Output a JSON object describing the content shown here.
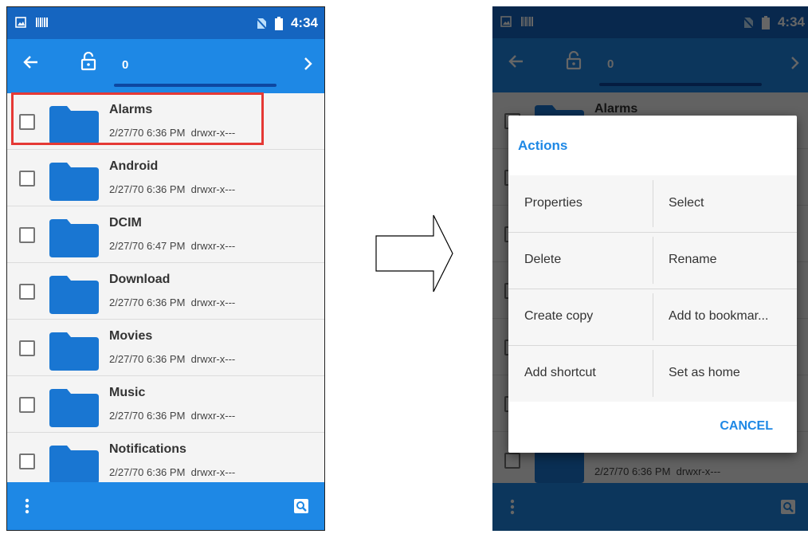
{
  "status": {
    "time": "4:34"
  },
  "toolbar": {
    "selection_count": "0"
  },
  "folders": [
    {
      "name": "Alarms",
      "date": "2/27/70 6:36 PM",
      "perms": "drwxr-x---"
    },
    {
      "name": "Android",
      "date": "2/27/70 6:36 PM",
      "perms": "drwxr-x---"
    },
    {
      "name": "DCIM",
      "date": "2/27/70 6:47 PM",
      "perms": "drwxr-x---"
    },
    {
      "name": "Download",
      "date": "2/27/70 6:36 PM",
      "perms": "drwxr-x---"
    },
    {
      "name": "Movies",
      "date": "2/27/70 6:36 PM",
      "perms": "drwxr-x---"
    },
    {
      "name": "Music",
      "date": "2/27/70 6:36 PM",
      "perms": "drwxr-x---"
    },
    {
      "name": "Notifications",
      "date": "2/27/70 6:36 PM",
      "perms": "drwxr-x---"
    }
  ],
  "dialog": {
    "title": "Actions",
    "actions": [
      "Properties",
      "Select",
      "Delete",
      "Rename",
      "Create copy",
      "Add to bookmar...",
      "Add shortcut",
      "Set as home"
    ],
    "cancel": "CANCEL"
  },
  "colors": {
    "primary": "#1e88e5",
    "status_bar": "#1565c0",
    "folder": "#1976d2",
    "highlight": "#e53935"
  },
  "icons": [
    "picture-icon",
    "barcode-icon",
    "no-sim-icon",
    "battery-icon",
    "back-arrow-icon",
    "unlock-icon",
    "chevron-right-icon",
    "folder-icon",
    "overflow-menu-icon",
    "search-icon",
    "transition-arrow-icon"
  ]
}
